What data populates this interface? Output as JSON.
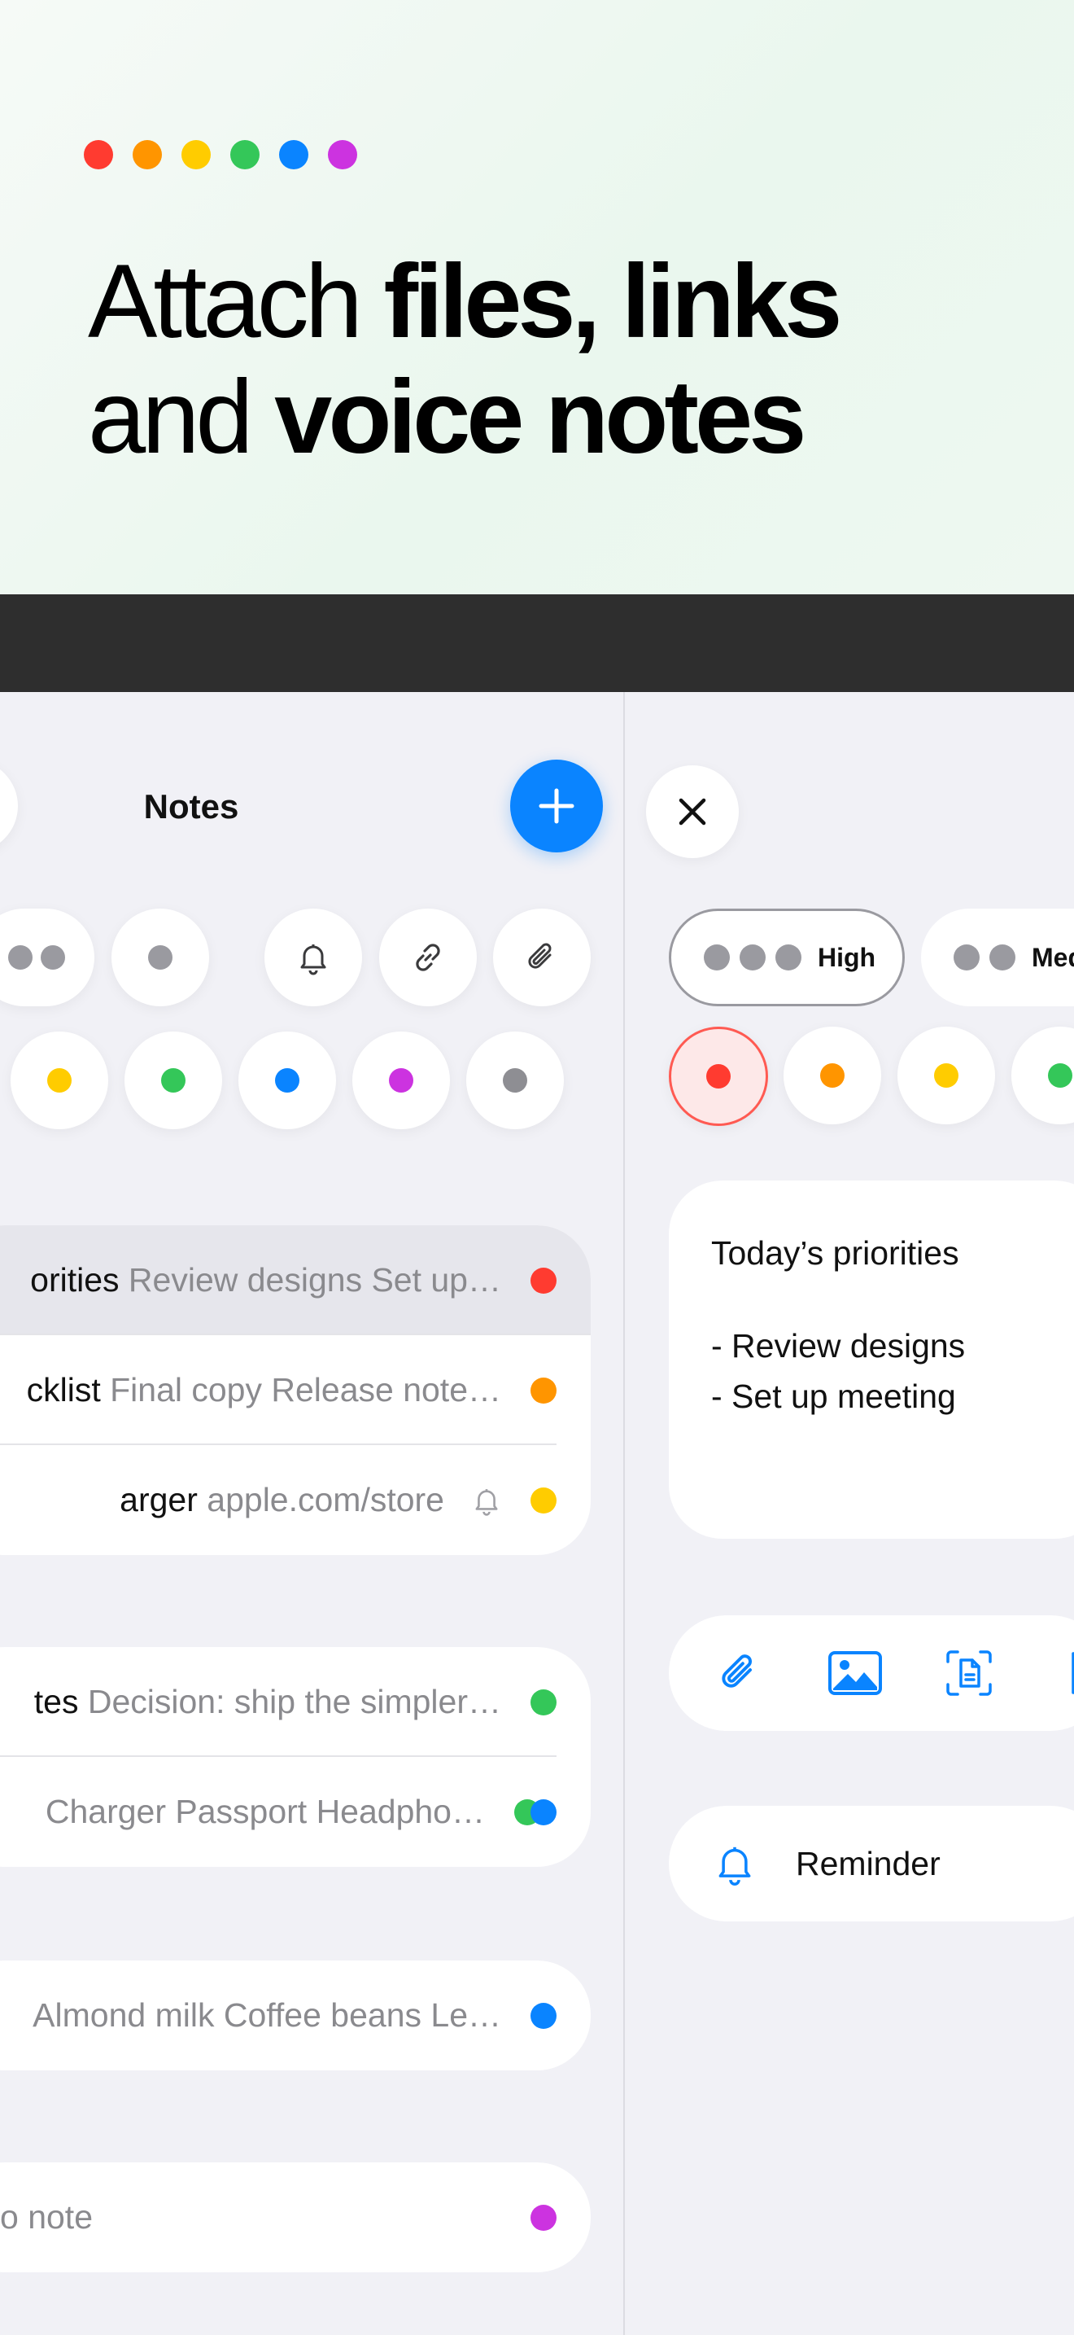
{
  "hero": {
    "dot_colors": [
      "#ff3b30",
      "#ff9500",
      "#ffcc00",
      "#34c759",
      "#0a84ff",
      "#cc33e0"
    ],
    "headline_line1_regular": "Attach ",
    "headline_line1_bold": "files, links",
    "headline_line2_regular": "and ",
    "headline_line2_bold": "voice notes"
  },
  "notes_list": {
    "title": "Notes",
    "add_icon": "plus-icon",
    "filter_icons": [
      "bell-icon",
      "link-icon",
      "paperclip-icon"
    ],
    "color_filters": [
      "#ffcc00",
      "#34c759",
      "#0a84ff",
      "#cc33e0",
      "#8e8e93"
    ],
    "groups": [
      {
        "notes": [
          {
            "name": "orities",
            "preview": " Review designs Set up…",
            "color": "#ff3b30",
            "selected": true
          },
          {
            "name": "cklist",
            "preview": " Final copy Release note…",
            "color": "#ff9500"
          },
          {
            "name": "arger",
            "preview": " apple.com/store",
            "color": "#ffcc00",
            "icon": "bell-icon"
          }
        ]
      },
      {
        "notes": [
          {
            "name": "tes",
            "preview": " Decision: ship the simpler…",
            "color": "#34c759"
          },
          {
            "name": "",
            "preview": "Charger Passport Headpho…",
            "color": "#0a84ff",
            "color2": "#34c759"
          }
        ]
      },
      {
        "notes": [
          {
            "name": "",
            "preview": "Almond milk Coffee beans Le…",
            "color": "#0a84ff"
          }
        ]
      },
      {
        "notes": [
          {
            "name": "",
            "preview": "o note",
            "color": "#cc33e0"
          }
        ]
      }
    ]
  },
  "editor": {
    "close_icon": "close-icon",
    "priorities": [
      {
        "label": "High",
        "dots": 3,
        "selected": true
      },
      {
        "label": "Med",
        "dots": 2,
        "selected": false
      }
    ],
    "colors": [
      "#ff3b30",
      "#ff9500",
      "#ffcc00",
      "#34c759"
    ],
    "selected_color": "#ff3b30",
    "note_line1": "Today’s priorities",
    "note_line2": "- Review designs",
    "note_line3": "- Set up meeting",
    "toolbar_icons": [
      "paperclip-icon",
      "photo-icon",
      "scan-document-icon",
      "more-icon"
    ],
    "reminder_icon": "bell-icon",
    "reminder_label": "Reminder"
  }
}
